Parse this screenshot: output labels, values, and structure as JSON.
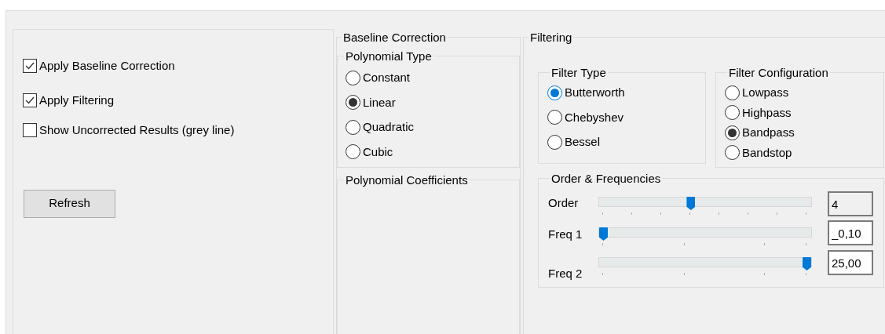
{
  "options": [
    {
      "label": "Apply Baseline Correction",
      "checked": true
    },
    {
      "label": "Apply Filtering",
      "checked": true
    },
    {
      "label": "Show Uncorrected Results (grey line)",
      "checked": false
    }
  ],
  "refresh_button": "Refresh",
  "baseline_correction": {
    "title": "Baseline Correction",
    "polynomial_type": {
      "title": "Polynomial Type",
      "options": [
        {
          "label": "Constant",
          "selected": false
        },
        {
          "label": "Linear",
          "selected": true
        },
        {
          "label": "Quadratic",
          "selected": false
        },
        {
          "label": "Cubic",
          "selected": false
        }
      ]
    },
    "polynomial_coefficients": {
      "title": "Polynomial Coefficients"
    }
  },
  "filtering": {
    "title": "Filtering",
    "filter_type": {
      "title": "Filter Type",
      "options": [
        {
          "label": "Butterworth",
          "selected": true
        },
        {
          "label": "Chebyshev",
          "selected": false
        },
        {
          "label": "Bessel",
          "selected": false
        }
      ]
    },
    "filter_configuration": {
      "title": "Filter Configuration",
      "options": [
        {
          "label": "Lowpass",
          "selected": false
        },
        {
          "label": "Highpass",
          "selected": false
        },
        {
          "label": "Bandpass",
          "selected": true
        },
        {
          "label": "Bandstop",
          "selected": false
        }
      ]
    },
    "order_frequencies": {
      "title": "Order & Frequencies",
      "sliders": [
        {
          "kind": "order",
          "label": "Order",
          "level": 0.43,
          "value": "4",
          "readonly": true
        },
        {
          "kind": "frequency",
          "label": "Freq 1",
          "level": 0,
          "value": "_0,10",
          "readonly": false
        },
        {
          "kind": "frequency",
          "label": "Freq 2",
          "level": 1,
          "value": "25,00",
          "readonly": false
        }
      ]
    }
  }
}
